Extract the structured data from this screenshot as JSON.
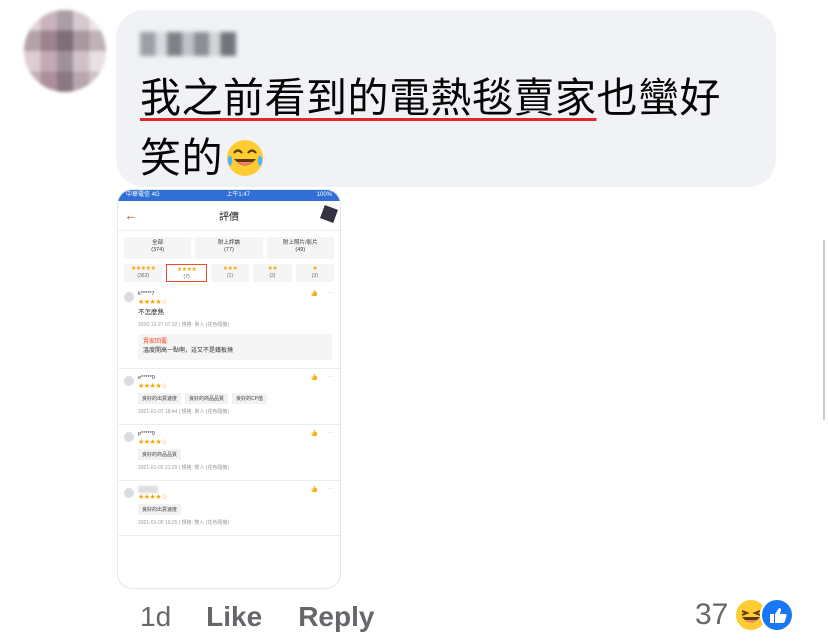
{
  "comment": {
    "text_underlined": "我之前看到的電熱毯賣家",
    "text_rest": "也蠻好笑的"
  },
  "screenshot": {
    "status": {
      "left": "中華電信 4G",
      "time": "上午1:47",
      "right": "100%"
    },
    "header_title": "評價",
    "filters_row1": [
      {
        "label": "全部",
        "count": "(374)"
      },
      {
        "label": "附上評論",
        "count": "(77)"
      },
      {
        "label": "附上照片/影片",
        "count": "(49)"
      }
    ],
    "filters_row2": [
      {
        "stars": "★★★★★",
        "count": "(363)"
      },
      {
        "stars": "★★★★",
        "count": "(7)"
      },
      {
        "stars": "★★★",
        "count": "(1)"
      },
      {
        "stars": "★★",
        "count": "(2)"
      },
      {
        "stars": "★",
        "count": "(3)"
      }
    ],
    "reviews": [
      {
        "user": "k*****7",
        "stars": "★★★★☆",
        "body": "不怎麼熱",
        "meta": "2020-12-27 07:32 | 規格: 單人 (花色隨機)",
        "reply_label": "賣家回覆:",
        "reply_text": "溫度開高一點啊，這又不是鐵板燒"
      },
      {
        "user": "e*****0",
        "stars": "★★★★☆",
        "tags": [
          "良好的出貨速度",
          "良好的商品品質",
          "良好的CP值"
        ],
        "meta": "2021-01-07 18:44 | 規格: 單人 (花色隨機)"
      },
      {
        "user": "p*****9",
        "stars": "★★★★☆",
        "tags": [
          "良好的商品品質"
        ],
        "meta": "2021-01-02 21:29 | 規格: 雙人 (花色隨機)"
      },
      {
        "user": "",
        "stars": "★★★★☆",
        "tags": [
          "良好的出貨速度"
        ],
        "meta": "2021-01-05 10:25 | 規格: 雙人 (花色隨機)"
      }
    ]
  },
  "actions": {
    "time": "1d",
    "like": "Like",
    "reply": "Reply"
  },
  "reactions": {
    "count": "37"
  },
  "colors": {
    "bubble": "#f0f2f5",
    "underline": "#e02828",
    "brand": "#ee4d2d",
    "star": "#f6a700",
    "fb_blue": "#1877f2"
  }
}
